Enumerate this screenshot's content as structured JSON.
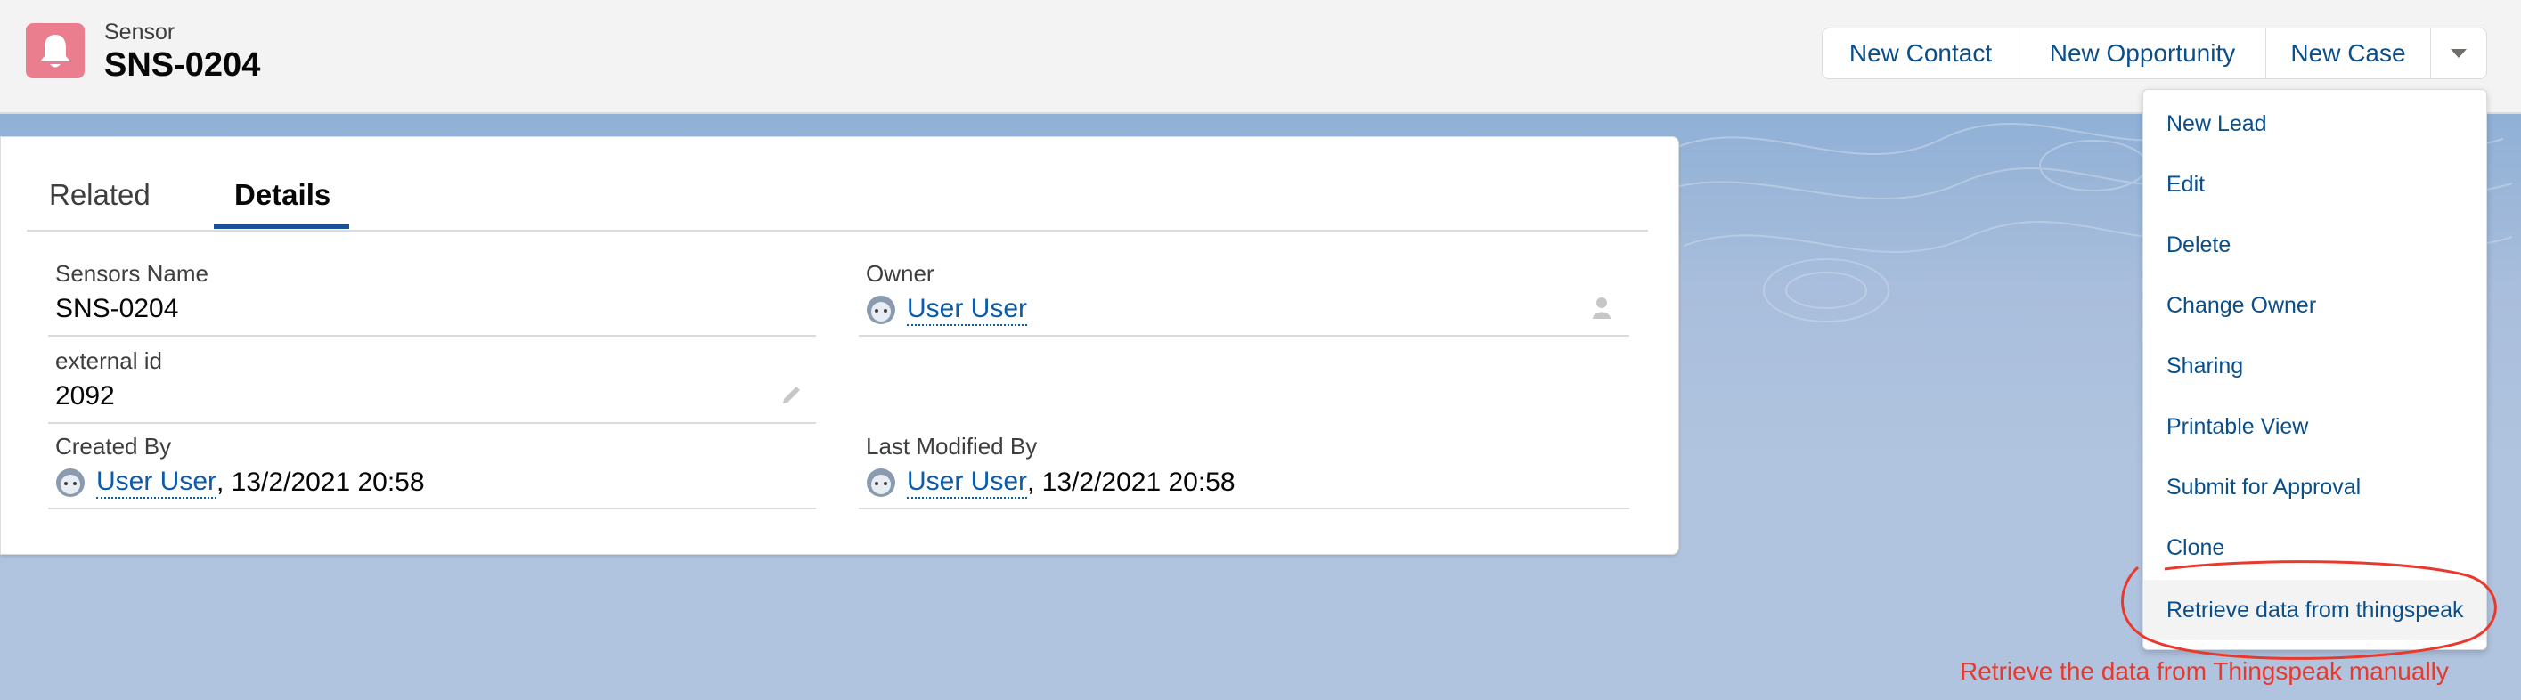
{
  "header": {
    "object_type": "Sensor",
    "record_name": "SNS-0204",
    "icon": "bell-icon",
    "icon_color": "#ea7e8e",
    "actions": [
      "New Contact",
      "New Opportunity",
      "New Case"
    ],
    "more_icon": "chevron-down-icon"
  },
  "tabs": [
    {
      "label": "Related",
      "active": false
    },
    {
      "label": "Details",
      "active": true
    }
  ],
  "details": {
    "sensors_name": {
      "label": "Sensors Name",
      "value": "SNS-0204"
    },
    "owner": {
      "label": "Owner",
      "value": "User User"
    },
    "external_id": {
      "label": "external id",
      "value": "2092"
    },
    "created_by": {
      "label": "Created By",
      "user": "User User",
      "date": ", 13/2/2021 20:58"
    },
    "last_modified_by": {
      "label": "Last Modified By",
      "user": "User User",
      "date": ", 13/2/2021 20:58"
    }
  },
  "menu": {
    "items": [
      "New Lead",
      "Edit",
      "Delete",
      "Change Owner",
      "Sharing",
      "Printable View",
      "Submit for Approval",
      "Clone",
      "Retrieve data from thingspeak"
    ]
  },
  "annotation": {
    "text": "Retrieve the data from Thingspeak manually",
    "color": "#e8392c"
  },
  "colors": {
    "link": "#0b5cab",
    "brand": "#1b5297",
    "background": "#b0c4df"
  }
}
